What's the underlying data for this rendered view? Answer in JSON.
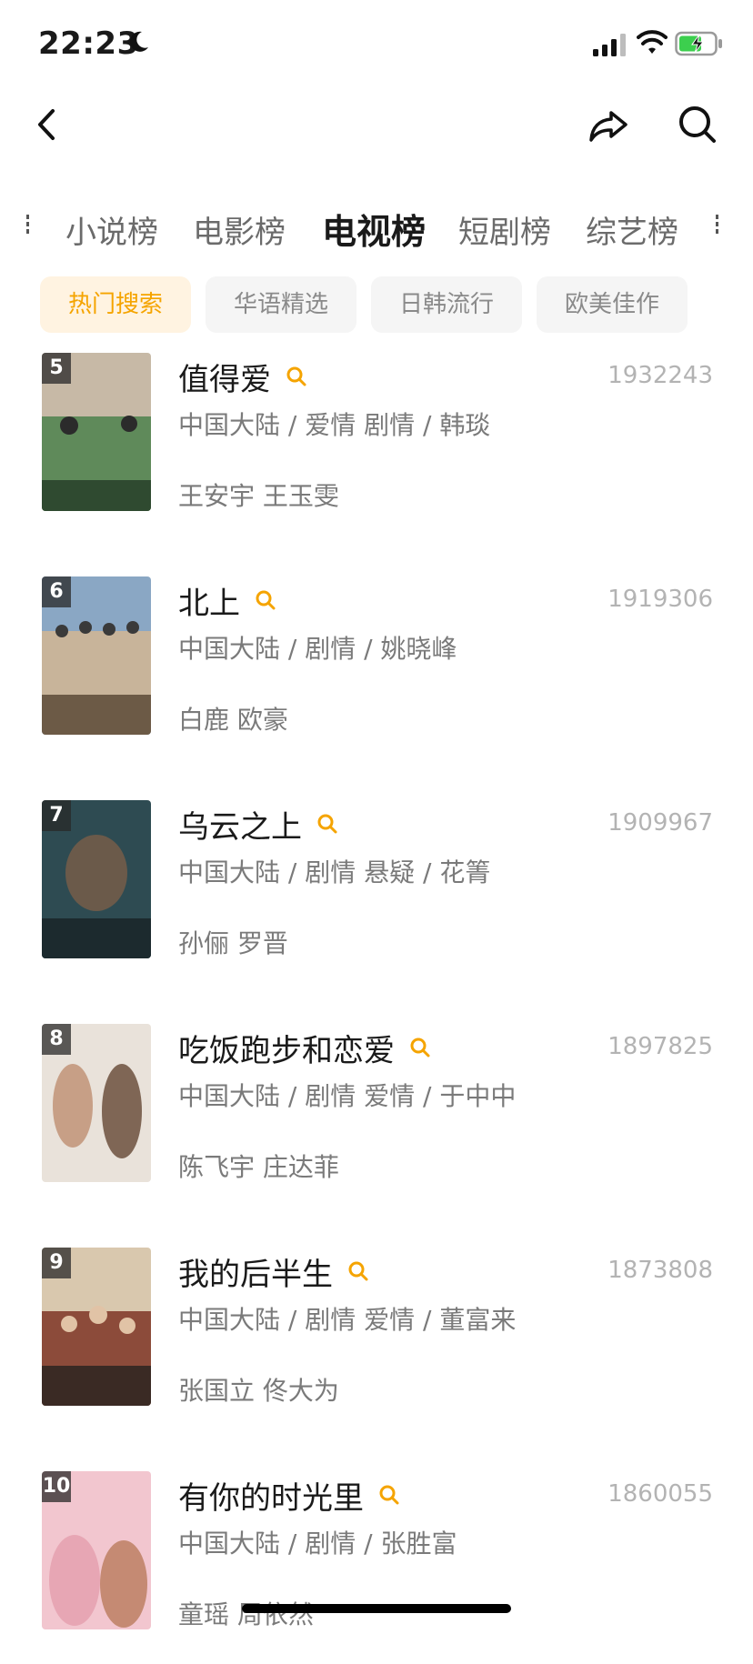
{
  "status": {
    "time": "22:23"
  },
  "tabs": [
    "小说榜",
    "电影榜",
    "电视榜",
    "短剧榜",
    "综艺榜"
  ],
  "active_tab": "电视榜",
  "chips": [
    "热门搜索",
    "华语精选",
    "日韩流行",
    "欧美佳作"
  ],
  "active_chip": "热门搜索",
  "items": [
    {
      "rank": "5",
      "title": "值得爱",
      "count": "1932243",
      "meta": "中国大陆 / 爱情 剧情 / 韩琰",
      "cast": "王安宇 王玉雯",
      "poster_colors": [
        "#c7b9a6",
        "#5f8a5a",
        "#2f4a30"
      ]
    },
    {
      "rank": "6",
      "title": "北上",
      "count": "1919306",
      "meta": "中国大陆 / 剧情 / 姚晓峰",
      "cast": "白鹿 欧豪",
      "poster_colors": [
        "#8aa7c4",
        "#c8b49a",
        "#6c5a46"
      ]
    },
    {
      "rank": "7",
      "title": "乌云之上",
      "count": "1909967",
      "meta": "中国大陆 / 剧情 悬疑 / 花箐",
      "cast": "孙俪 罗晋",
      "poster_colors": [
        "#2e4b52",
        "#6b5a4a",
        "#1c2a2e"
      ]
    },
    {
      "rank": "8",
      "title": "吃饭跑步和恋爱",
      "count": "1897825",
      "meta": "中国大陆 / 剧情 爱情 / 于中中",
      "cast": "陈飞宇 庄达菲",
      "poster_colors": [
        "#e9e2da",
        "#c79f86",
        "#7f6655"
      ]
    },
    {
      "rank": "9",
      "title": "我的后半生",
      "count": "1873808",
      "meta": "中国大陆 / 剧情 爱情 / 董富来",
      "cast": "张国立 佟大为",
      "poster_colors": [
        "#d9c8ae",
        "#8c4b3a",
        "#3a2a24"
      ]
    },
    {
      "rank": "10",
      "title": "有你的时光里",
      "count": "1860055",
      "meta": "中国大陆 / 剧情 / 张胜富",
      "cast": "童瑶 周依然",
      "poster_colors": [
        "#f2c6cf",
        "#e7a6b4",
        "#c58a73"
      ]
    }
  ]
}
